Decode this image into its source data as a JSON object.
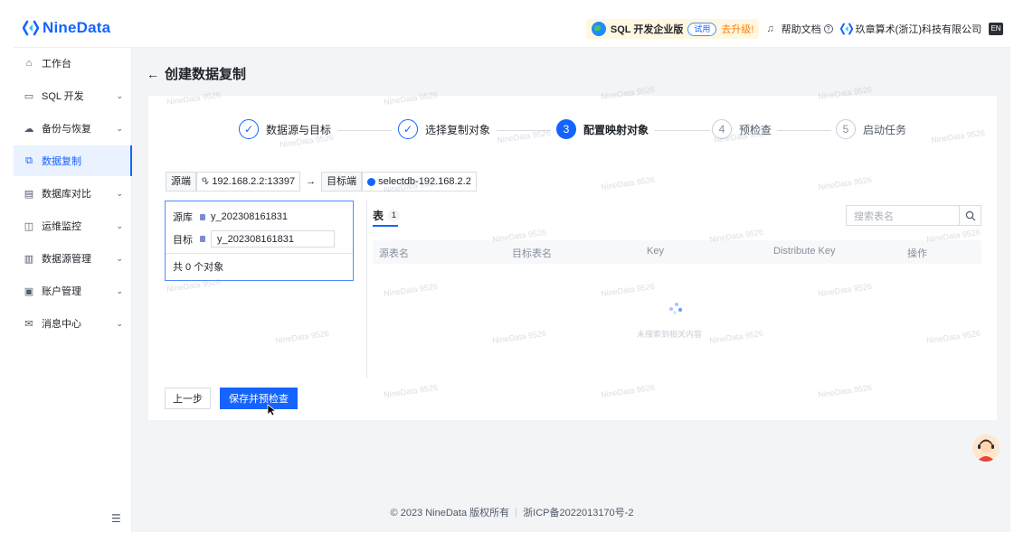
{
  "header": {
    "brand": "NineData",
    "edition_label": "SQL 开发企业版",
    "trial_badge": "试用",
    "upgrade_link": "去升级!",
    "help_link": "帮助文档",
    "company_name": "玖章算术(浙江)科技有限公司",
    "lang_label": "EN"
  },
  "sidebar": {
    "items": [
      {
        "label": "工作台",
        "icon": "home-icon",
        "has_submenu": false,
        "active": false
      },
      {
        "label": "SQL 开发",
        "icon": "terminal-icon",
        "has_submenu": true,
        "active": false
      },
      {
        "label": "备份与恢复",
        "icon": "cloud-backup-icon",
        "has_submenu": true,
        "active": false
      },
      {
        "label": "数据复制",
        "icon": "replication-icon",
        "has_submenu": false,
        "active": true
      },
      {
        "label": "数据库对比",
        "icon": "compare-icon",
        "has_submenu": true,
        "active": false
      },
      {
        "label": "运维监控",
        "icon": "monitor-icon",
        "has_submenu": true,
        "active": false
      },
      {
        "label": "数据源管理",
        "icon": "datasource-icon",
        "has_submenu": true,
        "active": false
      },
      {
        "label": "账户管理",
        "icon": "account-icon",
        "has_submenu": true,
        "active": false
      },
      {
        "label": "消息中心",
        "icon": "mail-icon",
        "has_submenu": true,
        "active": false
      }
    ]
  },
  "page": {
    "title": "创建数据复制"
  },
  "steps": [
    {
      "label": "数据源与目标",
      "state": "done",
      "num": "✓"
    },
    {
      "label": "选择复制对象",
      "state": "done",
      "num": "✓"
    },
    {
      "label": "配置映射对象",
      "state": "current",
      "num": "3"
    },
    {
      "label": "预检查",
      "state": "todo",
      "num": "4"
    },
    {
      "label": "启动任务",
      "state": "todo",
      "num": "5"
    }
  ],
  "route": {
    "source_tag": "源端",
    "source_value": "192.168.2.2:13397",
    "arrow": "→",
    "target_tag": "目标端",
    "target_value": "selectdb-192.168.2.2"
  },
  "mapping": {
    "source_db_label": "源库",
    "source_db_value": "y_202308161831",
    "target_db_label": "目标",
    "target_db_value": "y_202308161831",
    "count_text": "共 0 个对象"
  },
  "table_panel": {
    "tab_label": "表",
    "tab_count": "1",
    "search_placeholder": "搜索表名",
    "columns": [
      "源表名",
      "目标表名",
      "Key",
      "Distribute Key",
      "操作"
    ],
    "empty_text": "未搜索到相关内容"
  },
  "actions": {
    "prev_label": "上一步",
    "save_label": "保存并预检查"
  },
  "footer": {
    "copyright": "© 2023 NineData 版权所有",
    "icp": "浙ICP备2022013170号-2"
  },
  "watermark": "NineData 9526",
  "colors": {
    "accent": "#1664ff",
    "upgrade": "#ff7d00",
    "active_bg": "#eaf1ff"
  }
}
